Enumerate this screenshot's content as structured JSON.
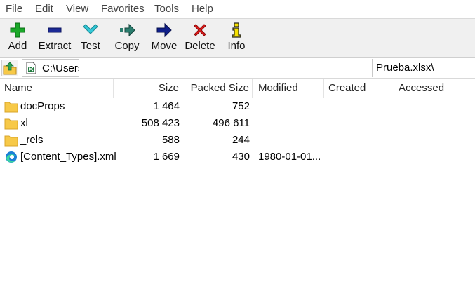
{
  "menu": [
    "File",
    "Edit",
    "View",
    "Favorites",
    "Tools",
    "Help"
  ],
  "toolbar": {
    "add": "Add",
    "extract": "Extract",
    "test": "Test",
    "copy": "Copy",
    "move": "Move",
    "delete": "Delete",
    "info": "Info"
  },
  "address": {
    "path_start": "C:\\Users",
    "path_end": "Prueba.xlsx\\"
  },
  "columns": {
    "name": "Name",
    "size": "Size",
    "packed": "Packed Size",
    "modified": "Modified",
    "created": "Created",
    "accessed": "Accessed"
  },
  "files": [
    {
      "name": "docProps",
      "size": "1 464",
      "packed": "752",
      "modified": "",
      "icon": "folder-icon"
    },
    {
      "name": "xl",
      "size": "508 423",
      "packed": "496 611",
      "modified": "",
      "icon": "folder-icon"
    },
    {
      "name": "_rels",
      "size": "588",
      "packed": "244",
      "modified": "",
      "icon": "folder-icon"
    },
    {
      "name": "[Content_Types].xml",
      "size": "1 669",
      "packed": "430",
      "modified": "1980-01-01...",
      "icon": "edge-browser-icon"
    }
  ],
  "colors": {
    "add_green": "#1aa829",
    "extract_blue": "#1c2a96",
    "test_cyan": "#33c9d8",
    "copy_teal": "#2a7d6e",
    "move_navy": "#0f1f8a",
    "delete_red": "#e01b1b",
    "info_yellow": "#f5e000",
    "folder_yellow": "#f7c948"
  }
}
